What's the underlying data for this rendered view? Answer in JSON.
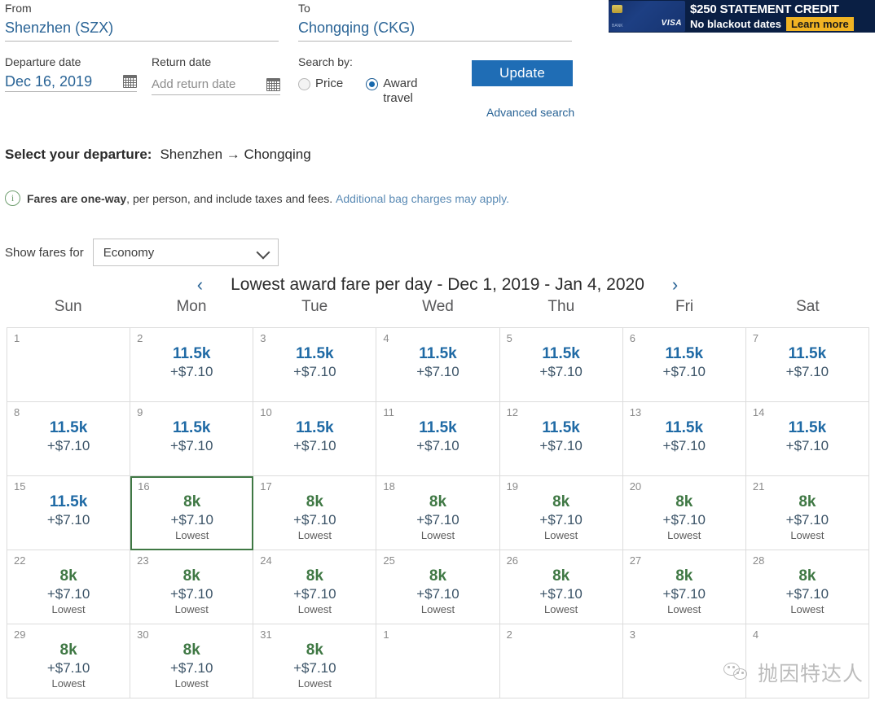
{
  "search": {
    "from_label": "From",
    "from_value": "Shenzhen (SZX)",
    "to_label": "To",
    "to_value": "Chongqing (CKG)",
    "departure_label": "Departure date",
    "departure_value": "Dec 16, 2019",
    "return_label": "Return date",
    "return_placeholder": "Add return date",
    "searchby_label": "Search by:",
    "option_price": "Price",
    "option_award": "Award travel",
    "selected_option": "Award travel",
    "update_label": "Update",
    "advanced_search_label": "Advanced search",
    "accent_blue": "#1f6db5",
    "link_blue": "#2a6496"
  },
  "ad": {
    "headline": "$250 STATEMENT CREDIT",
    "subline": "No blackout dates",
    "cta": "Learn more",
    "card_brand": "VISA",
    "card_bank": "BANK",
    "bg_color": "#0a1f44",
    "cta_color": "#f0b323"
  },
  "departure": {
    "title": "Select your departure:",
    "route": "Shenzhen → Chongqing",
    "note_bold": "Fares are one-way",
    "note_rest": ", per person, and include taxes and fees.",
    "note_link": "Additional bag charges may apply."
  },
  "fare_filter": {
    "label": "Show fares for",
    "selected": "Economy",
    "options": [
      "Economy"
    ]
  },
  "calendar": {
    "title": "Lowest award fare per day - Dec 1, 2019 - Jan 4, 2020",
    "prev_label": "‹",
    "next_label": "›",
    "day_headers": [
      "Sun",
      "Mon",
      "Tue",
      "Wed",
      "Thu",
      "Fri",
      "Sat"
    ],
    "lowest_label": "Lowest",
    "selected_day": 16,
    "miles_blue": "#1f6aa5",
    "miles_green": "#3f7844",
    "selected_border": "#3f7844",
    "cells": [
      {
        "day": "1",
        "miles": "",
        "tax": "",
        "lowest": false,
        "tone": "",
        "selected": false
      },
      {
        "day": "2",
        "miles": "11.5k",
        "tax": "+$7.10",
        "lowest": false,
        "tone": "blue",
        "selected": false
      },
      {
        "day": "3",
        "miles": "11.5k",
        "tax": "+$7.10",
        "lowest": false,
        "tone": "blue",
        "selected": false
      },
      {
        "day": "4",
        "miles": "11.5k",
        "tax": "+$7.10",
        "lowest": false,
        "tone": "blue",
        "selected": false
      },
      {
        "day": "5",
        "miles": "11.5k",
        "tax": "+$7.10",
        "lowest": false,
        "tone": "blue",
        "selected": false
      },
      {
        "day": "6",
        "miles": "11.5k",
        "tax": "+$7.10",
        "lowest": false,
        "tone": "blue",
        "selected": false
      },
      {
        "day": "7",
        "miles": "11.5k",
        "tax": "+$7.10",
        "lowest": false,
        "tone": "blue",
        "selected": false
      },
      {
        "day": "8",
        "miles": "11.5k",
        "tax": "+$7.10",
        "lowest": false,
        "tone": "blue",
        "selected": false
      },
      {
        "day": "9",
        "miles": "11.5k",
        "tax": "+$7.10",
        "lowest": false,
        "tone": "blue",
        "selected": false
      },
      {
        "day": "10",
        "miles": "11.5k",
        "tax": "+$7.10",
        "lowest": false,
        "tone": "blue",
        "selected": false
      },
      {
        "day": "11",
        "miles": "11.5k",
        "tax": "+$7.10",
        "lowest": false,
        "tone": "blue",
        "selected": false
      },
      {
        "day": "12",
        "miles": "11.5k",
        "tax": "+$7.10",
        "lowest": false,
        "tone": "blue",
        "selected": false
      },
      {
        "day": "13",
        "miles": "11.5k",
        "tax": "+$7.10",
        "lowest": false,
        "tone": "blue",
        "selected": false
      },
      {
        "day": "14",
        "miles": "11.5k",
        "tax": "+$7.10",
        "lowest": false,
        "tone": "blue",
        "selected": false
      },
      {
        "day": "15",
        "miles": "11.5k",
        "tax": "+$7.10",
        "lowest": false,
        "tone": "blue",
        "selected": false
      },
      {
        "day": "16",
        "miles": "8k",
        "tax": "+$7.10",
        "lowest": true,
        "tone": "green",
        "selected": true
      },
      {
        "day": "17",
        "miles": "8k",
        "tax": "+$7.10",
        "lowest": true,
        "tone": "green",
        "selected": false
      },
      {
        "day": "18",
        "miles": "8k",
        "tax": "+$7.10",
        "lowest": true,
        "tone": "green",
        "selected": false
      },
      {
        "day": "19",
        "miles": "8k",
        "tax": "+$7.10",
        "lowest": true,
        "tone": "green",
        "selected": false
      },
      {
        "day": "20",
        "miles": "8k",
        "tax": "+$7.10",
        "lowest": true,
        "tone": "green",
        "selected": false
      },
      {
        "day": "21",
        "miles": "8k",
        "tax": "+$7.10",
        "lowest": true,
        "tone": "green",
        "selected": false
      },
      {
        "day": "22",
        "miles": "8k",
        "tax": "+$7.10",
        "lowest": true,
        "tone": "green",
        "selected": false
      },
      {
        "day": "23",
        "miles": "8k",
        "tax": "+$7.10",
        "lowest": true,
        "tone": "green",
        "selected": false
      },
      {
        "day": "24",
        "miles": "8k",
        "tax": "+$7.10",
        "lowest": true,
        "tone": "green",
        "selected": false
      },
      {
        "day": "25",
        "miles": "8k",
        "tax": "+$7.10",
        "lowest": true,
        "tone": "green",
        "selected": false
      },
      {
        "day": "26",
        "miles": "8k",
        "tax": "+$7.10",
        "lowest": true,
        "tone": "green",
        "selected": false
      },
      {
        "day": "27",
        "miles": "8k",
        "tax": "+$7.10",
        "lowest": true,
        "tone": "green",
        "selected": false
      },
      {
        "day": "28",
        "miles": "8k",
        "tax": "+$7.10",
        "lowest": true,
        "tone": "green",
        "selected": false
      },
      {
        "day": "29",
        "miles": "8k",
        "tax": "+$7.10",
        "lowest": true,
        "tone": "green",
        "selected": false
      },
      {
        "day": "30",
        "miles": "8k",
        "tax": "+$7.10",
        "lowest": true,
        "tone": "green",
        "selected": false
      },
      {
        "day": "31",
        "miles": "8k",
        "tax": "+$7.10",
        "lowest": true,
        "tone": "green",
        "selected": false
      },
      {
        "day": "1",
        "miles": "",
        "tax": "",
        "lowest": false,
        "tone": "",
        "selected": false
      },
      {
        "day": "2",
        "miles": "",
        "tax": "",
        "lowest": false,
        "tone": "",
        "selected": false
      },
      {
        "day": "3",
        "miles": "",
        "tax": "",
        "lowest": false,
        "tone": "",
        "selected": false
      },
      {
        "day": "4",
        "miles": "",
        "tax": "",
        "lowest": false,
        "tone": "",
        "selected": false
      }
    ]
  },
  "watermark": {
    "text": "抛因特达人"
  }
}
